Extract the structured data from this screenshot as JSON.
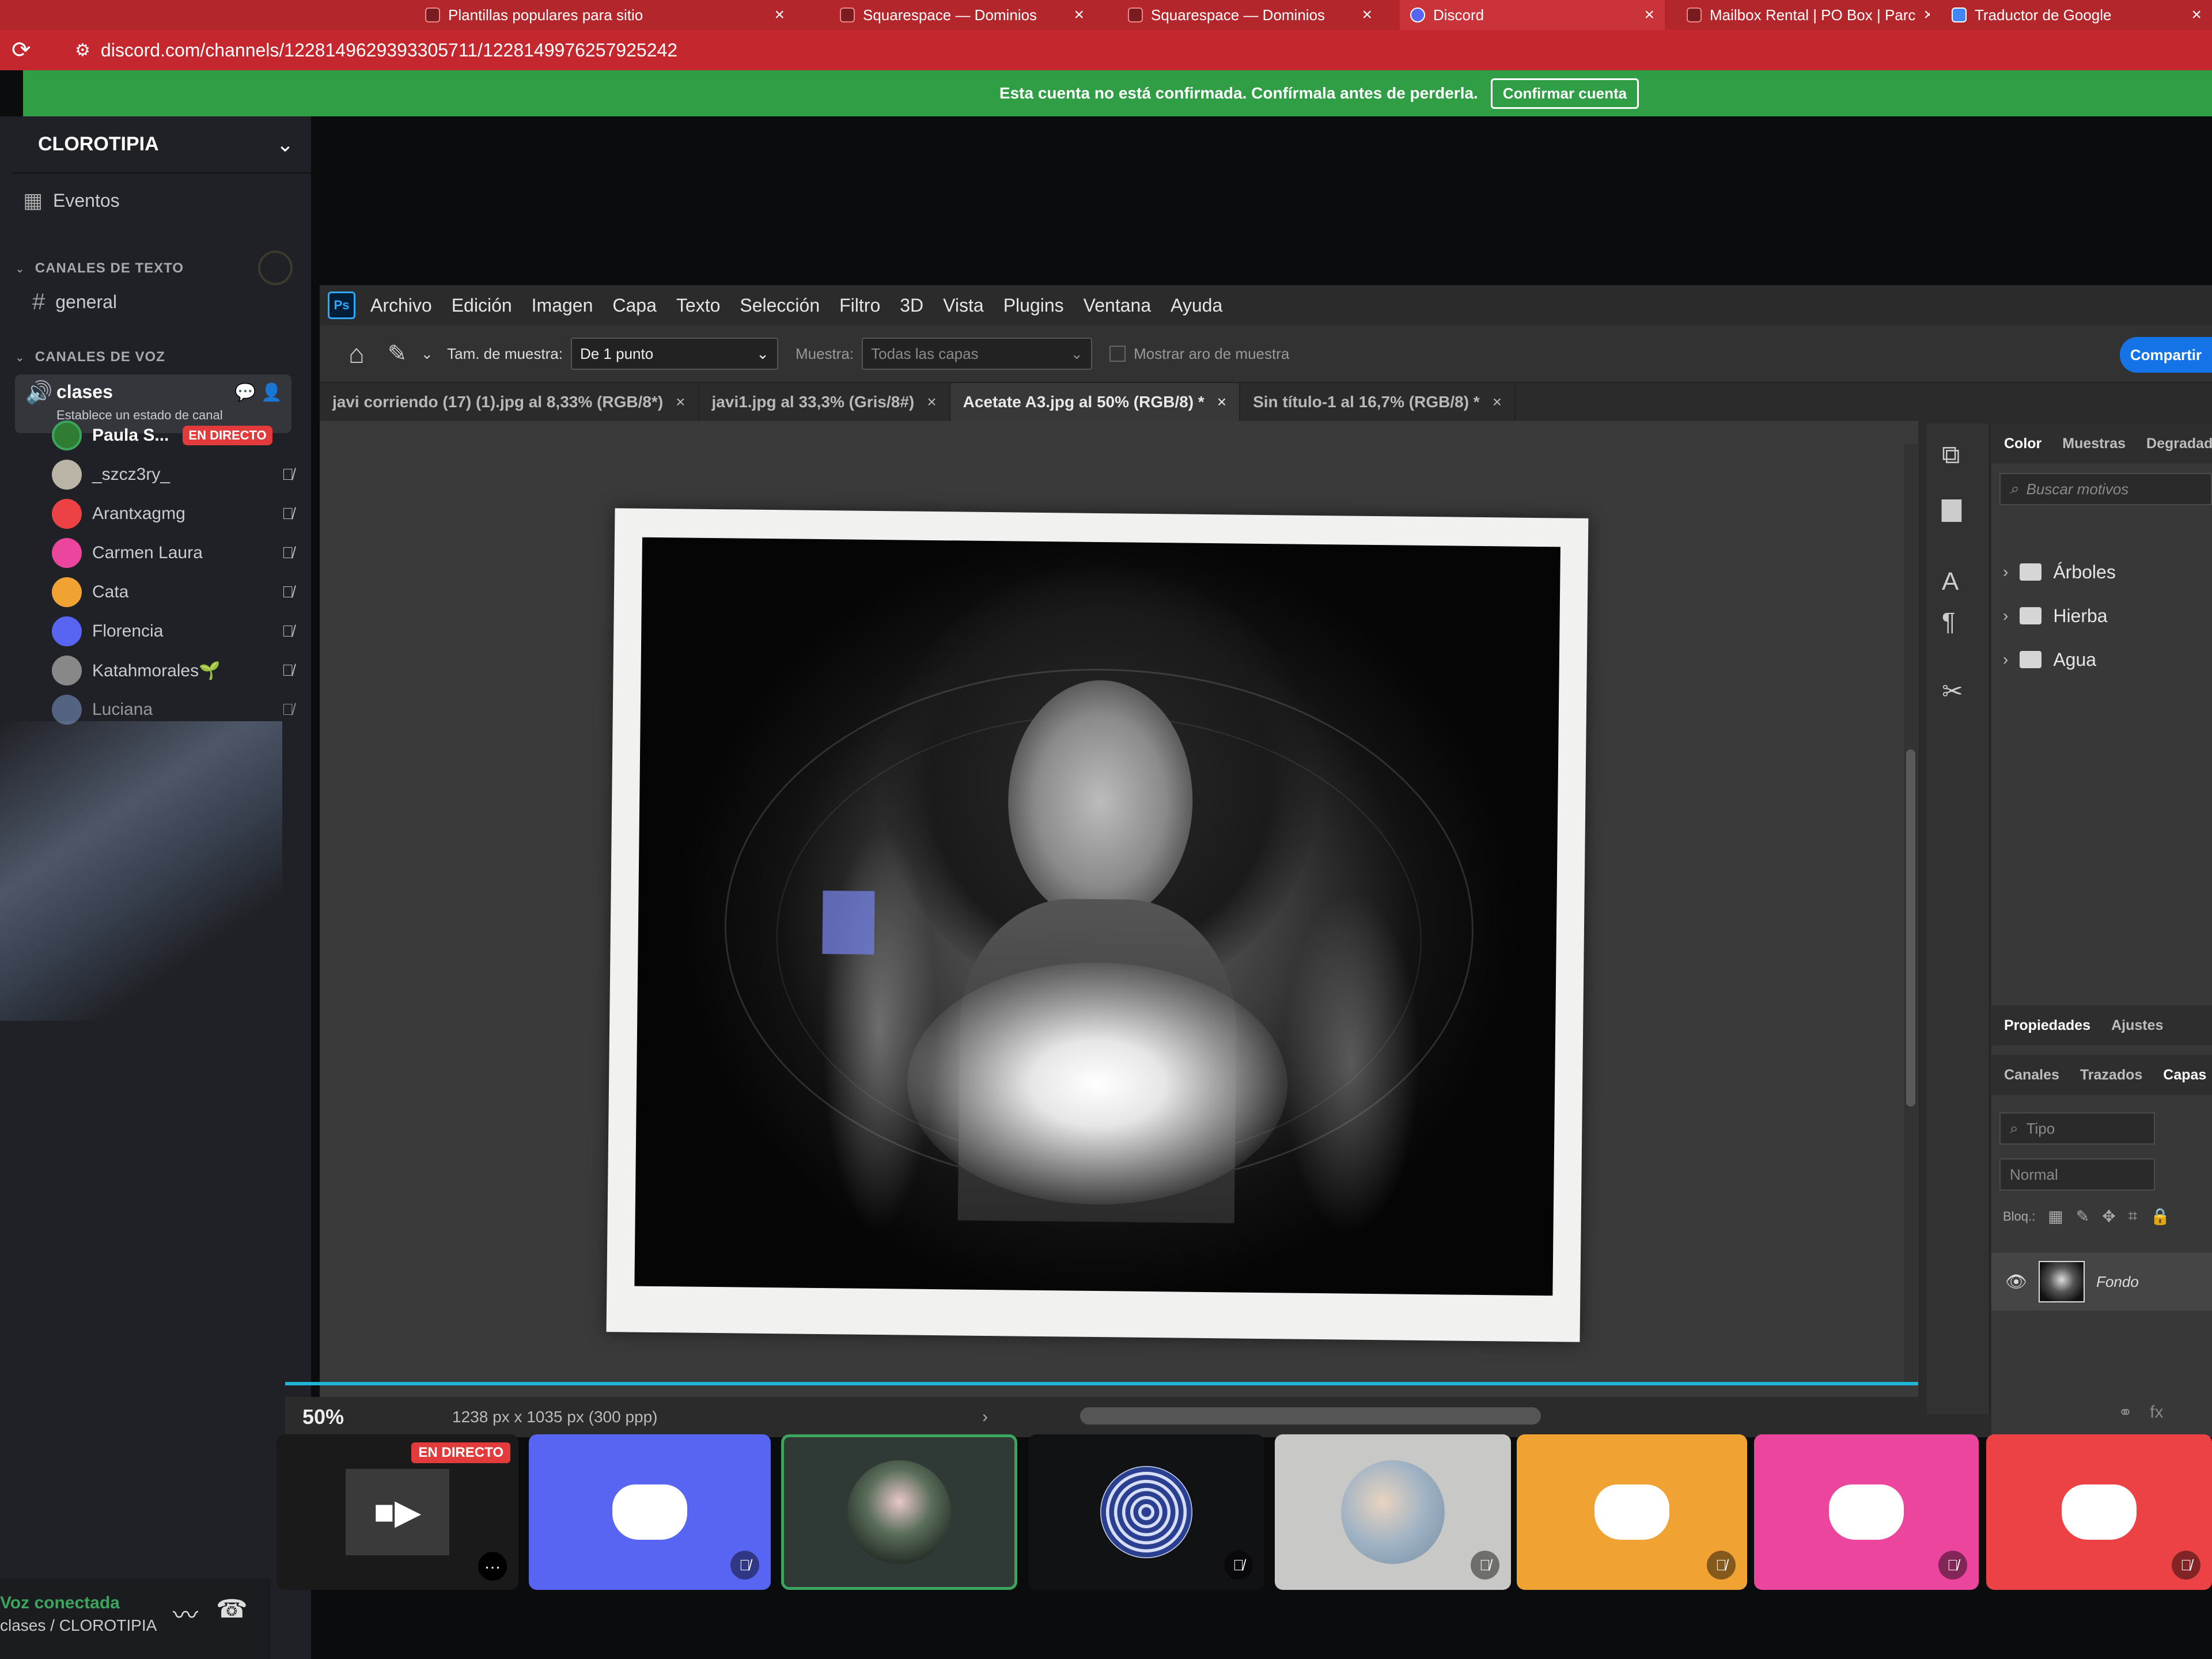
{
  "browser": {
    "tabs": [
      {
        "label": "Plantillas populares para sitio",
        "left": 0
      },
      {
        "label": "Squarespace — Dominios"
      },
      {
        "label": "Squarespace — Dominios"
      },
      {
        "label": "Discord"
      },
      {
        "label": "Mailbox Rental | PO Box | Parc"
      },
      {
        "label": "Traductor de Google"
      }
    ],
    "url": "discord.com/channels/1228149629393305711/1228149976257925242"
  },
  "banner": {
    "text": "Esta cuenta no está confirmada. Confírmala antes de perderla.",
    "button": "Confirmar cuenta"
  },
  "sidebar": {
    "server_name": "CLOROTIPIA",
    "events": "Eventos",
    "text_category": "CANALES DE TEXTO",
    "text_channel": "general",
    "voice_category": "CANALES DE VOZ",
    "voice_channel": "clases",
    "voice_status": "Establece un estado de canal",
    "users": [
      {
        "name": "Paula S...",
        "live": "EN DIRECTO",
        "color": "#2e7d32"
      },
      {
        "name": "_szcz3ry_",
        "color": "#b9b4a6"
      },
      {
        "name": "Arantxagmg",
        "color": "#ed4245"
      },
      {
        "name": "Carmen Laura",
        "color": "#eb459e"
      },
      {
        "name": "Cata",
        "color": "#f0a232"
      },
      {
        "name": "Florencia",
        "color": "#5865f2"
      },
      {
        "name": "Katahmorales🌱",
        "color": "#888888"
      },
      {
        "name": "Luciana",
        "color": "#6a7fa8"
      }
    ],
    "connection": "Voz conectada",
    "connection_server": "clases / CLOROTIPIA"
  },
  "photoshop": {
    "logo": "Ps",
    "menu": [
      "Archivo",
      "Edición",
      "Imagen",
      "Capa",
      "Texto",
      "Selección",
      "Filtro",
      "3D",
      "Vista",
      "Plugins",
      "Ventana",
      "Ayuda"
    ],
    "options": {
      "sample_size_label": "Tam. de muestra:",
      "sample_size_value": "De 1 punto",
      "sample_label": "Muestra:",
      "sample_value": "Todas las capas",
      "show_ring": "Mostrar aro de muestra",
      "share": "Compartir"
    },
    "doc_tabs": [
      "javi corriendo (17) (1).jpg al 8,33% (RGB/8*)",
      "javi1.jpg al 33,3% (Gris/8#)",
      "Acetate A3.jpg al 50% (RGB/8) *",
      "Sin título-1 al 16,7% (RGB/8) *"
    ],
    "zoom": "50%",
    "doc_info": "1238 px x 1035 px (300 ppp)",
    "panel_tabs_top": [
      "Color",
      "Muestras",
      "Degradados"
    ],
    "pattern_search": "Buscar motivos",
    "pattern_groups": [
      "Árboles",
      "Hierba",
      "Agua"
    ],
    "panel_tabs_mid": [
      "Propiedades",
      "Ajustes"
    ],
    "panel_tabs_layers": [
      "Canales",
      "Trazados",
      "Capas"
    ],
    "layer_search": "Tipo",
    "blend_mode": "Normal",
    "lock_label": "Bloq.:",
    "layer_name": "Fondo"
  },
  "video_strip": {
    "live_label": "EN DIRECTO",
    "tiles": [
      {
        "kind": "stream",
        "color": "#1a1a1a"
      },
      {
        "kind": "discord",
        "color": "#5865f2"
      },
      {
        "kind": "avatar-photo",
        "color": "#2f3a36"
      },
      {
        "kind": "avatar-pattern",
        "color": "#111214"
      },
      {
        "kind": "avatar-sky",
        "color": "#c8c8c6"
      },
      {
        "kind": "discord",
        "color": "#f0a232"
      },
      {
        "kind": "discord",
        "color": "#eb459e"
      },
      {
        "kind": "discord",
        "color": "#ed4245"
      }
    ]
  }
}
